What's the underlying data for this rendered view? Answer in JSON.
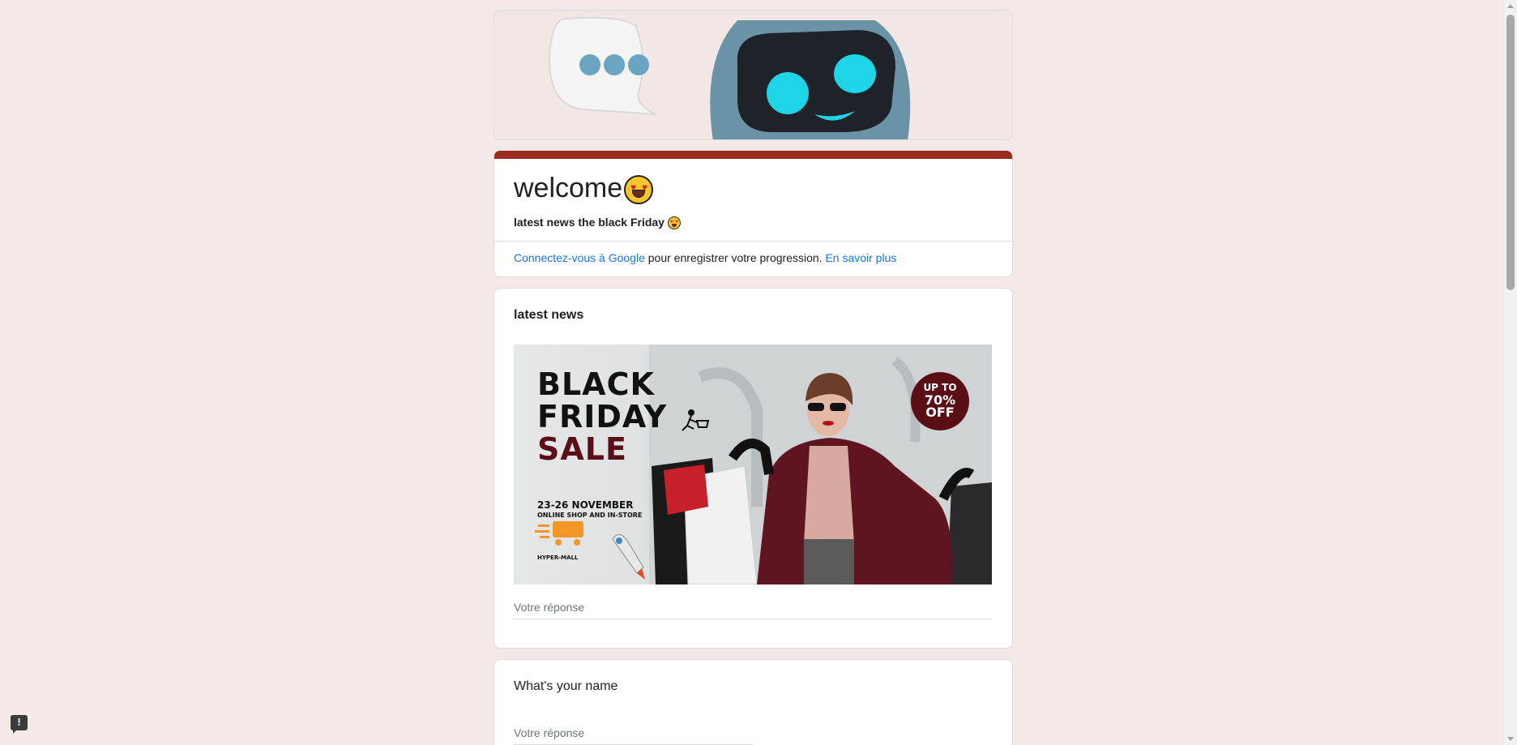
{
  "form": {
    "title": "welcome",
    "description": "latest news  the black Friday",
    "signin_link": "Connectez-vous à Google",
    "signin_text": " pour enregistrer votre progression. ",
    "learn_more": "En savoir plus"
  },
  "questions": [
    {
      "title": "latest news",
      "image": {
        "line1": "BLACK",
        "line2": "FRIDAY",
        "line3": "SALE",
        "dates": "23-26 NOVEMBER",
        "subtitle": "ONLINE SHOP AND IN-STORE",
        "store": "HYPER-MALL",
        "badge_top": "UP TO",
        "badge_mid": "70%",
        "badge_bottom": "OFF"
      },
      "placeholder": "Votre réponse"
    },
    {
      "title": "What's your name",
      "placeholder": "Votre réponse"
    }
  ],
  "colors": {
    "page_bg": "#f5e9e8",
    "accent": "#9b2a1f",
    "link": "#1a73e8"
  },
  "icons": [
    "robot-banner-image",
    "chat-bubble-icon",
    "heart-eyes-emoji-icon",
    "report-problem-icon"
  ]
}
